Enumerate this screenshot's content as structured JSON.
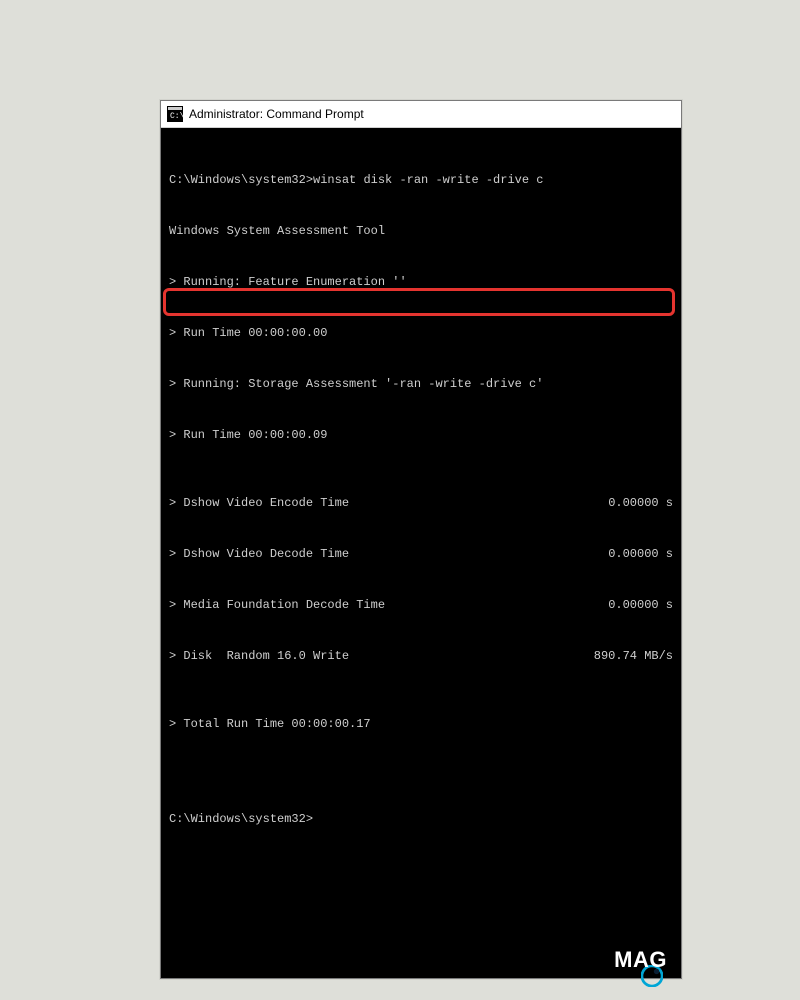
{
  "window": {
    "title": "Administrator: Command Prompt"
  },
  "term": {
    "prompt1": "C:\\Windows\\system32>",
    "command": "winsat disk -ran -write -drive c",
    "line2": "Windows System Assessment Tool",
    "line3": "> Running: Feature Enumeration ''",
    "line4": "> Run Time 00:00:00.00",
    "line5": "> Running: Storage Assessment '-ran -write -drive c'",
    "line6": "> Run Time 00:00:00.09",
    "timings": [
      {
        "label": "> Dshow Video Encode Time",
        "value": "0.00000 s"
      },
      {
        "label": "> Dshow Video Decode Time",
        "value": "0.00000 s"
      },
      {
        "label": "> Media Foundation Decode Time",
        "value": "0.00000 s"
      },
      {
        "label": "> Disk  Random 16.0 Write",
        "value": "890.74 MB/s"
      }
    ],
    "line_total": "> Total Run Time 00:00:00.17",
    "prompt2": "C:\\Windows\\system32>"
  },
  "watermark": {
    "text": "MAG"
  }
}
